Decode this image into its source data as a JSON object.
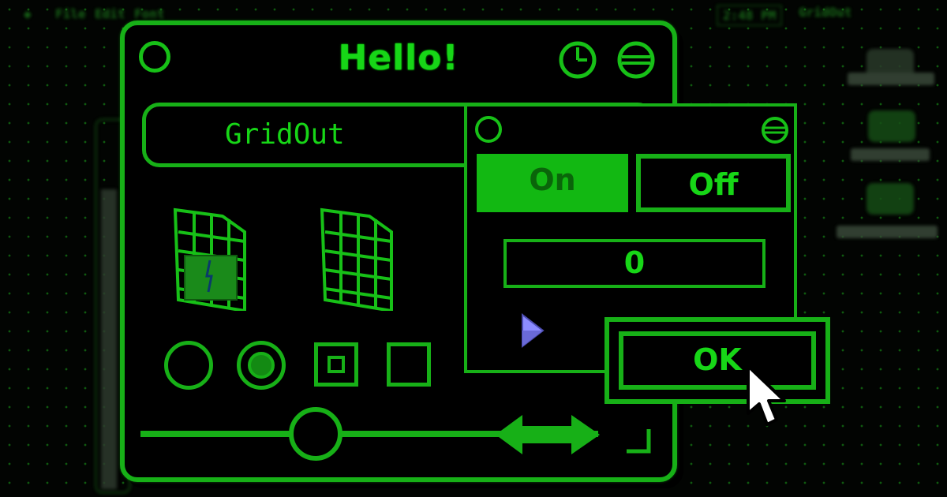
{
  "menubar": {
    "m1": "File",
    "m2": "Edit",
    "m3": "Font",
    "clock": "2:48 PM",
    "app": "GridOut"
  },
  "main_window": {
    "title": "Hello!",
    "name_field": "GridOut",
    "slider_level": 0.3
  },
  "popup_window": {
    "toggle_on_label": "On",
    "toggle_off_label": "Off",
    "value": "0"
  },
  "ok_dialog": {
    "ok_label": "OK"
  },
  "colors": {
    "accent": "#17b017",
    "background": "#000000",
    "toggle_on_fill": "#12b812"
  },
  "icons": [
    "close-box-icon",
    "clock-icon",
    "collapse-icon",
    "folder-grid-icon",
    "finder-face-icon",
    "cursor-arrow-icon",
    "arrow-pointer-icon",
    "resize-grip-icon",
    "double-arrow-icon"
  ]
}
